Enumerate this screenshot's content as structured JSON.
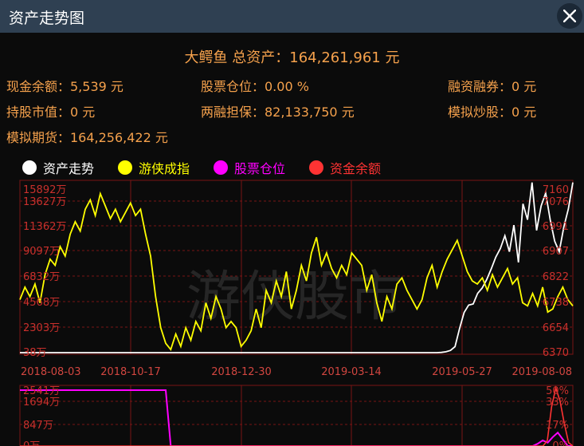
{
  "window": {
    "title": "资产走势图"
  },
  "summary": "大鳄鱼 总资产：164,261,961 元",
  "info": {
    "cash": "现金余额：5,539 元",
    "position": "股票仓位：0.00 %",
    "margin_short": "融资融券：0 元",
    "stock_value": "持股市值：0 元",
    "margin_collateral": "两融担保：82,133,750 元",
    "sim_stock": "模拟炒股：0 元",
    "futures": "模拟期货：164,256,422 元"
  },
  "legend": [
    {
      "label": "资产走势",
      "color": "#ffffff"
    },
    {
      "label": "游侠成指",
      "color": "#ffff00"
    },
    {
      "label": "股票仓位",
      "color": "#ff00ff"
    },
    {
      "label": "资金余额",
      "color": "#ff3333"
    }
  ],
  "colors": {
    "grid": "#7a1515",
    "text_orange": "#f5a14c",
    "asset": "#ffffff",
    "index": "#ffff00",
    "position": "#ff00ff",
    "cash": "#ff3333"
  },
  "watermark": "游侠股市",
  "chart_data": [
    {
      "type": "line",
      "title": "",
      "x_labels": [
        "2018-08-03",
        "2018-10-17",
        "2018-12-30",
        "2019-03-14",
        "2019-05-27",
        "2019-08-08"
      ],
      "y_left_ticks": [
        "15892万",
        "13627万",
        "11362万",
        "9097万",
        "6832万",
        "4568万",
        "2303万",
        "38万"
      ],
      "y_right_ticks": [
        "7160",
        "7076",
        "6991",
        "6907",
        "6822",
        "6738",
        "6654",
        "6370"
      ],
      "series": [
        {
          "name": "资产走势",
          "axis": "left",
          "values": [
            38,
            38,
            38,
            38,
            38,
            38,
            38,
            38,
            38,
            38,
            38,
            38,
            38,
            38,
            38,
            38,
            38,
            38,
            38,
            38,
            38,
            38,
            38,
            38,
            38,
            38,
            38,
            38,
            38,
            38,
            38,
            38,
            38,
            38,
            38,
            38,
            38,
            38,
            38,
            38,
            38,
            38,
            38,
            38,
            38,
            38,
            38,
            38,
            38,
            38,
            38,
            38,
            38,
            38,
            38,
            38,
            38,
            38,
            38,
            38,
            38,
            38,
            38,
            38,
            38,
            38,
            38,
            38,
            38,
            38,
            38,
            38,
            38,
            38,
            38,
            38,
            38,
            38,
            38,
            38,
            38,
            38,
            38,
            38,
            38,
            38,
            38,
            38,
            38,
            38,
            38,
            38,
            38,
            60,
            120,
            250,
            600,
            2300,
            3800,
            4500,
            4600,
            5600,
            6100,
            6900,
            7900,
            9000,
            9800,
            11000,
            9500,
            12000,
            8500,
            14000,
            12500,
            16000,
            11500,
            13800,
            15000,
            12500,
            10500,
            9500,
            11800,
            13500,
            16000
          ]
        },
        {
          "name": "游侠成指",
          "axis": "right",
          "values": [
            6790,
            6830,
            6800,
            6840,
            6780,
            6870,
            6920,
            6900,
            6960,
            6930,
            7000,
            7040,
            7010,
            7080,
            7110,
            7060,
            7130,
            7090,
            7050,
            7080,
            7040,
            7070,
            7100,
            7060,
            7080,
            7000,
            6930,
            6800,
            6700,
            6650,
            6630,
            6680,
            6640,
            6700,
            6660,
            6720,
            6690,
            6780,
            6730,
            6800,
            6760,
            6700,
            6720,
            6700,
            6640,
            6660,
            6690,
            6760,
            6700,
            6820,
            6780,
            6850,
            6800,
            6880,
            6760,
            6820,
            6900,
            6850,
            6940,
            6990,
            6900,
            6940,
            6890,
            6860,
            6900,
            6870,
            6940,
            6920,
            6900,
            6820,
            6870,
            6780,
            6720,
            6800,
            6760,
            6840,
            6860,
            6820,
            6790,
            6760,
            6790,
            6860,
            6900,
            6830,
            6880,
            6920,
            6950,
            6980,
            6930,
            6880,
            6850,
            6840,
            6860,
            6820,
            6870,
            6830,
            6860,
            6890,
            6840,
            6860,
            6780,
            6770,
            6810,
            6770,
            6830,
            6750,
            6760,
            6800,
            6830,
            6790,
            6770
          ]
        },
        {
          "name": "股票仓位",
          "axis": "bottom",
          "values": [
            50,
            50,
            50,
            50,
            50,
            50,
            50,
            50,
            50,
            50,
            50,
            50,
            50,
            50,
            50,
            50,
            50,
            50,
            50,
            50,
            50,
            50,
            50,
            50,
            50,
            50,
            50,
            50,
            50,
            50,
            0,
            0,
            0,
            0,
            0,
            0,
            0,
            0,
            0,
            0,
            0,
            0,
            0,
            0,
            0,
            0,
            0,
            0,
            0,
            0,
            0,
            0,
            0,
            0,
            0,
            0,
            0,
            0,
            0,
            0,
            0,
            0,
            0,
            0,
            0,
            0,
            0,
            0,
            0,
            0,
            0,
            0,
            0,
            0,
            0,
            0,
            0,
            0,
            0,
            0,
            0,
            0,
            0,
            0,
            0,
            0,
            0,
            0,
            0,
            0,
            0,
            0,
            0,
            0,
            0,
            0,
            0,
            0,
            0,
            0,
            0,
            0,
            0,
            2,
            5,
            3,
            8,
            12,
            6,
            0,
            0
          ]
        },
        {
          "name": "资金余额",
          "axis": "bottom",
          "values": [
            0,
            0,
            0,
            0,
            0,
            0,
            0,
            0,
            0,
            0,
            0,
            0,
            0,
            0,
            0,
            0,
            0,
            0,
            0,
            0,
            0,
            0,
            0,
            0,
            0,
            0,
            0,
            0,
            0,
            0,
            0,
            0,
            0,
            0,
            0,
            0,
            0,
            0,
            0,
            0,
            0,
            0,
            0,
            0,
            0,
            0,
            0,
            0,
            0,
            0,
            0,
            0,
            0,
            0,
            0,
            0,
            0,
            0,
            0,
            0,
            0,
            0,
            0,
            0,
            0,
            0,
            0,
            0,
            0,
            0,
            0,
            0,
            0,
            0,
            0,
            0,
            0,
            0,
            0,
            0,
            0,
            0,
            0,
            0,
            0,
            0,
            0,
            0,
            0,
            0,
            0,
            0,
            0,
            0,
            0,
            0,
            0,
            0,
            0,
            0,
            0,
            0,
            0,
            0,
            0,
            0,
            0,
            0,
            0,
            0,
            0,
            0,
            0,
            0,
            0,
            0,
            0,
            0,
            0,
            0,
            0,
            0,
            0,
            0,
            5,
            35,
            52,
            40,
            20,
            3,
            0
          ]
        }
      ]
    },
    {
      "type": "line",
      "title": "",
      "y_left_ticks": [
        "2541万",
        "1694万",
        "847万",
        "0万"
      ],
      "y_right_ticks": [
        "50%",
        "33%",
        "17%",
        "0%"
      ]
    }
  ]
}
